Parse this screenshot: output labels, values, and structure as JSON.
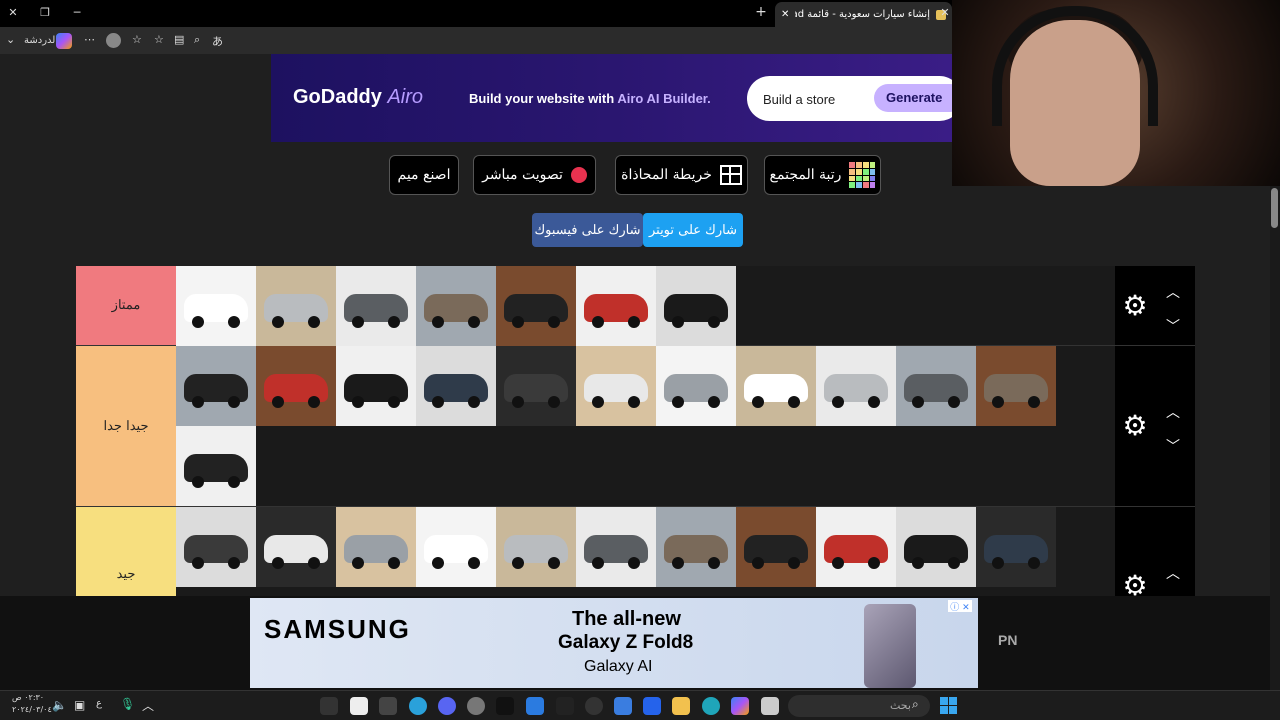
{
  "browser": {
    "tab_title": "إنشاء سيارات سعودية - قائمة Swaad",
    "profile_label": "الدردشة"
  },
  "ad_top": {
    "brand": "GoDaddy",
    "brand_suffix": "Airo",
    "text_prefix": "Build your website with",
    "text_highlight": "Airo AI Builder.",
    "input_value": "Build a store",
    "button_label": "Generate"
  },
  "actions": {
    "community_rank": "رتبة المجتمع",
    "align_map": "خريطة المحاذاة",
    "live_vote": "تصويت مباشر",
    "make_meme": "اصنع ميم",
    "share_twitter": "شارك على تويتر",
    "share_facebook": "شارك على فيسبوك"
  },
  "tiers": [
    {
      "label": "ممتاز",
      "color": "#f07a7f"
    },
    {
      "label": "جيدا جدا",
      "color": "#f7bf7f"
    },
    {
      "label": "جيد",
      "color": "#f7df7f"
    }
  ],
  "ad_bottom": {
    "brand": "SAMSUNG",
    "line1": "The all-new",
    "line2": "Galaxy Z Fold8",
    "line3": "Galaxy AI",
    "side_label": "PN"
  },
  "taskbar": {
    "search_placeholder": "بحث",
    "time": "٠٢:٣٠ ص",
    "date": "٢٠٢٤/٠٣/٠٤"
  }
}
